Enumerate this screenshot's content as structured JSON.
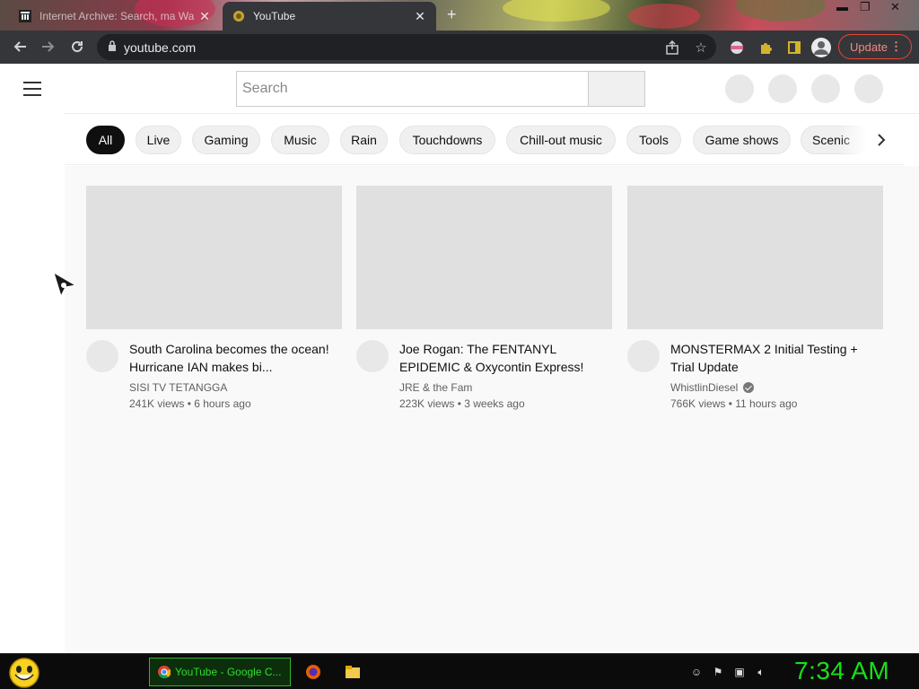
{
  "browser": {
    "tabs": [
      {
        "label": "Internet Archive: Search, ma Wa",
        "active": false
      },
      {
        "label": "YouTube",
        "active": true
      }
    ],
    "url": "youtube.com",
    "update_label": "Update"
  },
  "youtube": {
    "search_placeholder": "Search",
    "chips": [
      "All",
      "Live",
      "Gaming",
      "Music",
      "Rain",
      "Touchdowns",
      "Chill-out music",
      "Tools",
      "Game shows",
      "Scenic"
    ],
    "active_chip": "All",
    "videos": [
      {
        "title": "South Carolina becomes the ocean! Hurricane IAN makes bi...",
        "channel": "SISI TV TETANGGA",
        "views": "241K views",
        "age": "6 hours ago",
        "verified": false
      },
      {
        "title": "Joe Rogan: The FENTANYL EPIDEMIC & Oxycontin Express!",
        "channel": "JRE & the Fam",
        "views": "223K views",
        "age": "3 weeks ago",
        "verified": false
      },
      {
        "title": "MONSTERMAX 2 Initial Testing + Trial Update",
        "channel": "WhistlinDiesel",
        "views": "766K views",
        "age": "11 hours ago",
        "verified": true
      }
    ]
  },
  "taskbar": {
    "chrome_task_label": "YouTube - Google C...",
    "clock": "7:34 AM"
  },
  "colors": {
    "browser_frame": "#35363a",
    "omnibox": "#202124",
    "update_accent": "#e8453c",
    "chip_active": "#0f0f0f",
    "taskbar_green": "#18e018"
  },
  "icons": [
    "back-icon",
    "forward-icon",
    "reload-icon",
    "lock-icon",
    "share-icon",
    "bookmark-star-icon",
    "extension-icon",
    "puzzle-icon",
    "sidebar-icon",
    "profile-icon",
    "menu-icon",
    "chevron-right-icon",
    "verified-icon"
  ]
}
